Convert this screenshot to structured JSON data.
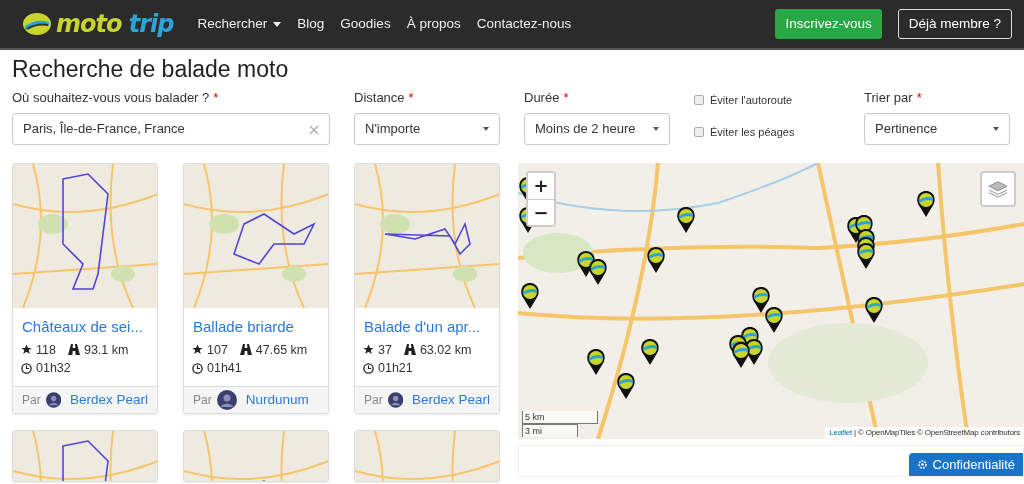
{
  "navbar": {
    "brand": "moto trip",
    "links": [
      {
        "label": "Rechercher",
        "dropdown": true
      },
      {
        "label": "Blog",
        "dropdown": false
      },
      {
        "label": "Goodies",
        "dropdown": false
      },
      {
        "label": "À propos",
        "dropdown": false
      },
      {
        "label": "Contactez-nous",
        "dropdown": false
      }
    ],
    "signup": "Inscrivez-vous",
    "login": "Déjà membre ?"
  },
  "title": "Recherche de balade moto",
  "form": {
    "location": {
      "label": "Où souhaitez-vous vous balader ?",
      "required_mark": "*",
      "value": "Paris, Île-de-France, France"
    },
    "distance": {
      "label": "Distance",
      "required_mark": "*",
      "value": "N'importe"
    },
    "duration": {
      "label": "Durée",
      "required_mark": "*",
      "value": "Moins de 2 heure"
    },
    "options": [
      {
        "label": "Éviter l'autoroute",
        "checked": false
      },
      {
        "label": "Éviter les péages",
        "checked": false
      }
    ],
    "sort": {
      "label": "Trier par",
      "required_mark": "*",
      "value": "Pertinence"
    }
  },
  "cards": [
    {
      "kind": "full",
      "title": "Châteaux de sei...",
      "likes": "118",
      "distance": "93.1 km",
      "duration": "01h32",
      "by": "Par",
      "author": "Berdex Pearl"
    },
    {
      "kind": "full",
      "title": "Ballade briarde",
      "likes": "107",
      "distance": "47.65 km",
      "duration": "01h41",
      "by": "Par",
      "author": "Nurdunum"
    },
    {
      "kind": "full",
      "title": "Balade d'un apr...",
      "likes": "37",
      "distance": "63.02 km",
      "duration": "01h21",
      "by": "Par",
      "author": "Berdex Pearl"
    },
    {
      "kind": "cut"
    },
    {
      "kind": "cut"
    },
    {
      "kind": "cut"
    }
  ],
  "map": {
    "zoom_in": "+",
    "zoom_out": "−",
    "scale_metric": "5 km",
    "scale_imperial": "3 mi",
    "attribution_leaflet": "Leaflet",
    "attribution_rest": "| © OpenMapTiles © OpenStreetMap contributors"
  },
  "ad": {
    "privacy_button": "Confidentialité"
  }
}
